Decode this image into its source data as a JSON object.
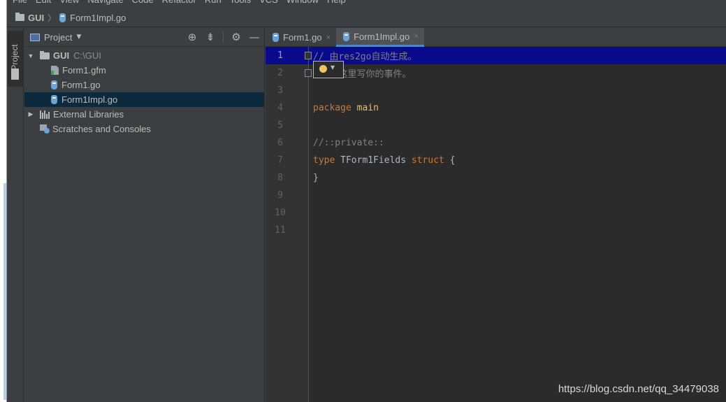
{
  "menu": [
    "File",
    "Edit",
    "View",
    "Navigate",
    "Code",
    "Refactor",
    "Run",
    "Tools",
    "VCS",
    "Window",
    "Help"
  ],
  "breadcrumb": {
    "project": "GUI",
    "file": "Form1Impl.go"
  },
  "tool_stripe": {
    "project_tab": "1: Project"
  },
  "project_panel": {
    "title": "Project",
    "icons": [
      "crosshair-icon",
      "collapse-icon",
      "gear-icon",
      "minimize-icon"
    ],
    "tree": [
      {
        "label": "GUI",
        "sub": "C:\\GUI",
        "kind": "folder",
        "expanded": true
      },
      {
        "label": "Form1.gfm",
        "kind": "gfm-file"
      },
      {
        "label": "Form1.go",
        "kind": "go-file"
      },
      {
        "label": "Form1Impl.go",
        "kind": "go-file",
        "selected": true
      },
      {
        "label": "External Libraries",
        "kind": "library",
        "expanded": false
      },
      {
        "label": "Scratches and Consoles",
        "kind": "scratch"
      }
    ]
  },
  "editor_tabs": [
    {
      "label": "Form1.go",
      "active": false,
      "close": "×"
    },
    {
      "label": "Form1Impl.go",
      "active": true,
      "close": "×"
    }
  ],
  "code_lines": [
    {
      "n": "1",
      "tokens": [
        {
          "t": "// 由res2go自动生成。",
          "c": "c-comment"
        }
      ]
    },
    {
      "n": "2",
      "tokens": [
        {
          "t": "// 在这里写你的事件。",
          "c": "c-comment"
        }
      ]
    },
    {
      "n": "3",
      "tokens": []
    },
    {
      "n": "4",
      "tokens": [
        {
          "t": "package",
          "c": "c-kw"
        },
        {
          "t": " main",
          "c": "c-type"
        }
      ]
    },
    {
      "n": "5",
      "tokens": []
    },
    {
      "n": "6",
      "tokens": [
        {
          "t": "//::private::",
          "c": "c-comment"
        }
      ]
    },
    {
      "n": "7",
      "tokens": [
        {
          "t": "type",
          "c": "c-kw"
        },
        {
          "t": " TForm1Fields ",
          "c": "c-plain"
        },
        {
          "t": "struct",
          "c": "c-kw"
        },
        {
          "t": " {",
          "c": "c-plain"
        }
      ]
    },
    {
      "n": "8",
      "tokens": [
        {
          "t": "}",
          "c": "c-plain"
        }
      ]
    },
    {
      "n": "9",
      "tokens": []
    },
    {
      "n": "10",
      "tokens": []
    },
    {
      "n": "11",
      "tokens": []
    }
  ],
  "watermark": "https://blog.csdn.net/qq_34479038",
  "colors": {
    "background": "#3c3f41",
    "editor": "#2b2b2b",
    "selection": "#0d293e",
    "current_line": "#0a0a8c",
    "accent": "#4a88c7"
  }
}
